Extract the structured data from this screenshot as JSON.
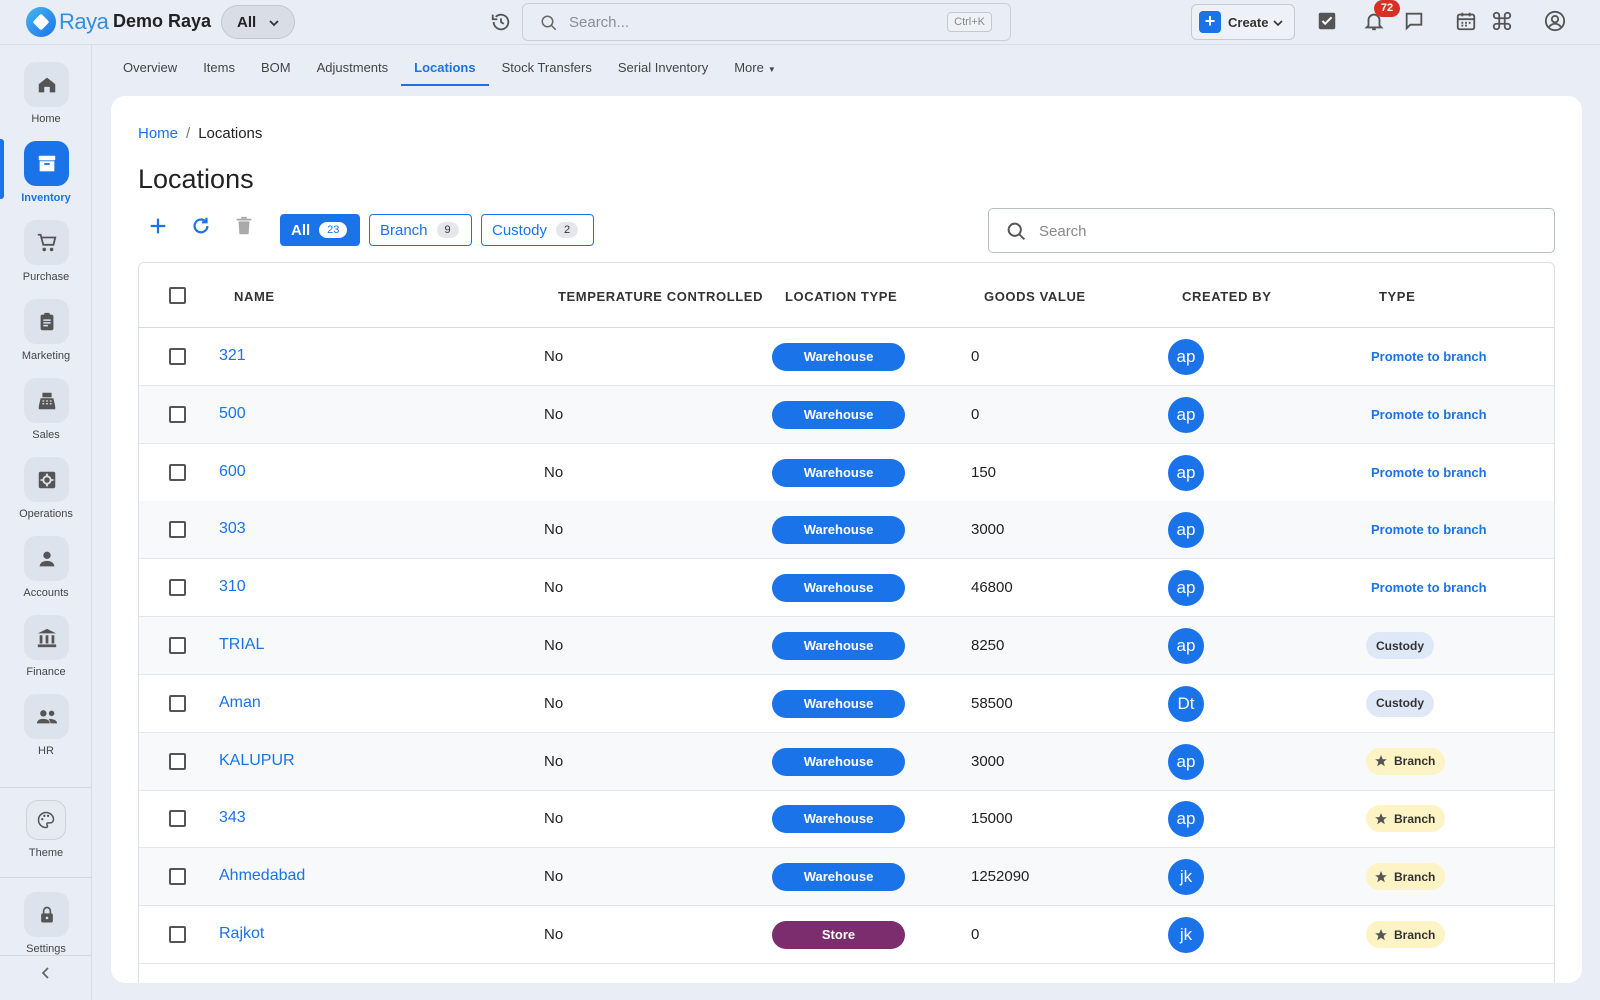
{
  "app": {
    "logo_text": "Raya",
    "org_name": "Demo Raya",
    "scope": "All"
  },
  "topbar": {
    "search_placeholder": "Search...",
    "search_shortcut": "Ctrl+K",
    "create_label": "Create",
    "notification_count": "72"
  },
  "sidebar": {
    "items": [
      {
        "label": "Home",
        "icon": "home-icon"
      },
      {
        "label": "Inventory",
        "icon": "inventory-icon"
      },
      {
        "label": "Purchase",
        "icon": "cart-icon"
      },
      {
        "label": "Marketing",
        "icon": "clipboard-icon"
      },
      {
        "label": "Sales",
        "icon": "register-icon"
      },
      {
        "label": "Operations",
        "icon": "gear-icon"
      },
      {
        "label": "Accounts",
        "icon": "person-icon"
      },
      {
        "label": "Finance",
        "icon": "bank-icon"
      },
      {
        "label": "HR",
        "icon": "people-icon"
      }
    ],
    "theme_label": "Theme",
    "settings_label": "Settings"
  },
  "tabs": [
    {
      "label": "Overview"
    },
    {
      "label": "Items"
    },
    {
      "label": "BOM"
    },
    {
      "label": "Adjustments"
    },
    {
      "label": "Locations"
    },
    {
      "label": "Stock Transfers"
    },
    {
      "label": "Serial Inventory"
    },
    {
      "label": "More"
    }
  ],
  "breadcrumb": {
    "home": "Home",
    "separator": "/",
    "current": "Locations"
  },
  "page": {
    "title": "Locations"
  },
  "filters": [
    {
      "label": "All",
      "count": "23"
    },
    {
      "label": "Branch",
      "count": "9"
    },
    {
      "label": "Custody",
      "count": "2"
    }
  ],
  "table_search": {
    "placeholder": "Search"
  },
  "table": {
    "columns": [
      "NAME",
      "TEMPERATURE CONTROLLED",
      "LOCATION TYPE",
      "GOODS VALUE",
      "CREATED BY",
      "TYPE"
    ],
    "rows": [
      {
        "name": "321",
        "temp": "No",
        "loc_type": "Warehouse",
        "goods": "0",
        "created_by": "ap",
        "type": "Promote to branch"
      },
      {
        "name": "500",
        "temp": "No",
        "loc_type": "Warehouse",
        "goods": "0",
        "created_by": "ap",
        "type": "Promote to branch"
      },
      {
        "name": "600",
        "temp": "No",
        "loc_type": "Warehouse",
        "goods": "150",
        "created_by": "ap",
        "type": "Promote to branch"
      },
      {
        "name": "303",
        "temp": "No",
        "loc_type": "Warehouse",
        "goods": "3000",
        "created_by": "ap",
        "type": "Promote to branch"
      },
      {
        "name": "310",
        "temp": "No",
        "loc_type": "Warehouse",
        "goods": "46800",
        "created_by": "ap",
        "type": "Promote to branch"
      },
      {
        "name": "TRIAL",
        "temp": "No",
        "loc_type": "Warehouse",
        "goods": "8250",
        "created_by": "ap",
        "type": "Custody"
      },
      {
        "name": "Aman",
        "temp": "No",
        "loc_type": "Warehouse",
        "goods": "58500",
        "created_by": "Dt",
        "type": "Custody"
      },
      {
        "name": "KALUPUR",
        "temp": "No",
        "loc_type": "Warehouse",
        "goods": "3000",
        "created_by": "ap",
        "type": "Branch"
      },
      {
        "name": "343",
        "temp": "No",
        "loc_type": "Warehouse",
        "goods": "15000",
        "created_by": "ap",
        "type": "Branch"
      },
      {
        "name": "Ahmedabad",
        "temp": "No",
        "loc_type": "Warehouse",
        "goods": "1252090",
        "created_by": "jk",
        "type": "Branch"
      },
      {
        "name": "Rajkot",
        "temp": "No",
        "loc_type": "Store",
        "goods": "0",
        "created_by": "jk",
        "type": "Branch"
      }
    ]
  },
  "colors": {
    "accent": "#1a73e8",
    "warehouse": "#1a73e8",
    "store": "#7b2d6e",
    "branch_chip": "#fdf3c4",
    "custody_chip": "#dfe8f7",
    "badge": "#d93025"
  }
}
